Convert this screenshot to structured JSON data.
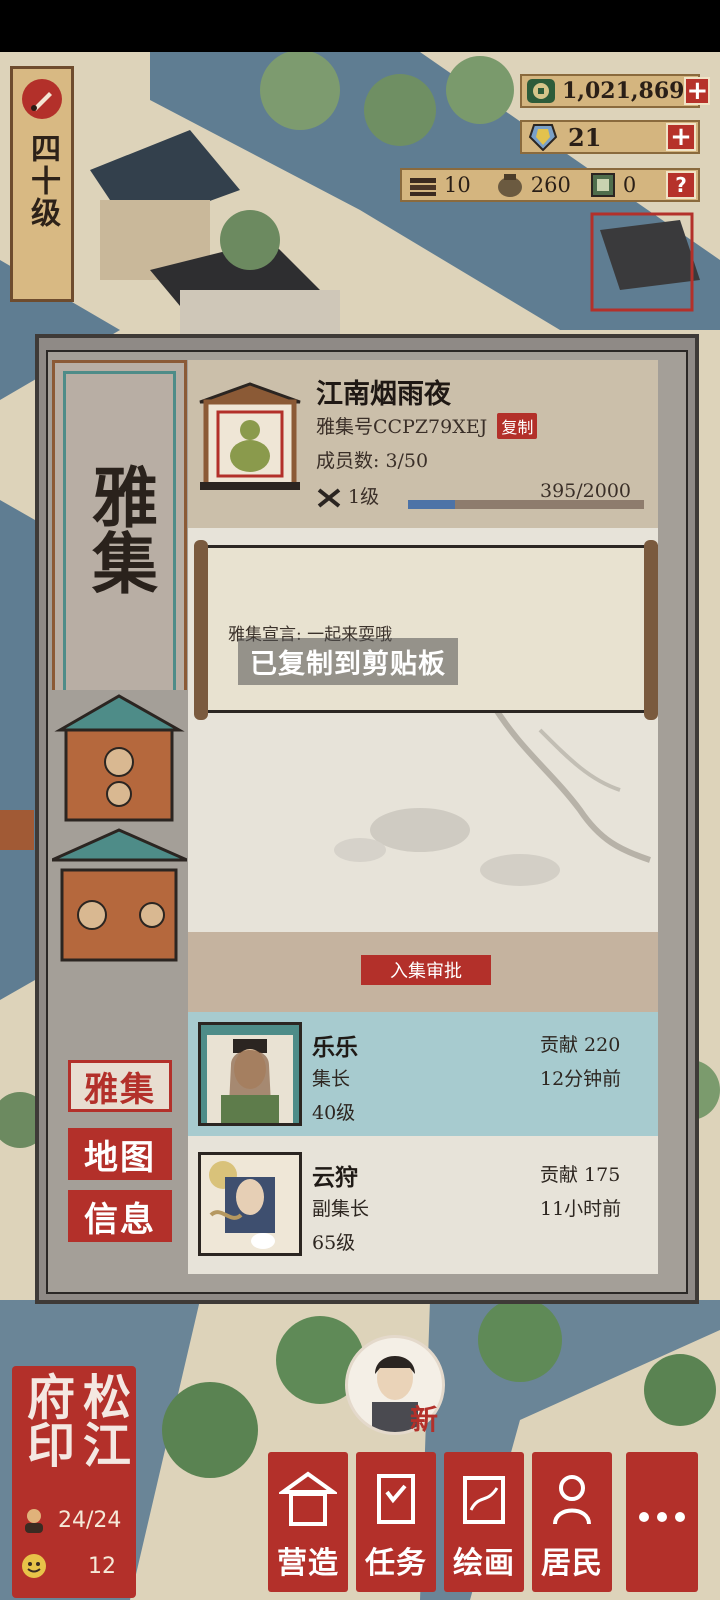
{
  "player": {
    "level_label": "四十级"
  },
  "currency": {
    "coins": "1,021,869",
    "gems": "21",
    "wood": "10",
    "grain": "260",
    "notes": "0"
  },
  "panel": {
    "side_title": "雅集",
    "tabs": [
      "雅集",
      "地图",
      "信息"
    ],
    "clan": {
      "name": "江南烟雨夜",
      "id_label": "雅集号CCPZ79XEJ",
      "copy_label": "复制",
      "members_label": "成员数: 3/50",
      "level_label": "1级",
      "exp_text": "395/2000",
      "exp_fraction": 0.1975
    },
    "declaration": "雅集宣言: 一起来耍哦",
    "toast": "已复制到剪贴板",
    "approve_button": "入集审批",
    "members": [
      {
        "name": "乐乐",
        "role": "集长",
        "level": "40级",
        "contribution": "贡献 220",
        "last_active": "12分钟前"
      },
      {
        "name": "云狩",
        "role": "副集长",
        "level": "65级",
        "contribution": "贡献 175",
        "last_active": "11小时前"
      }
    ]
  },
  "seal": {
    "text": "松江府印",
    "population": "24/24",
    "count": "12"
  },
  "npc": {
    "badge": "新"
  },
  "bottom_nav": [
    "营造",
    "任务",
    "绘画",
    "居民"
  ],
  "colors": {
    "accent_red": "#b3302a",
    "teal": "#4e8c88",
    "member_highlight": "#a7cbcf"
  }
}
